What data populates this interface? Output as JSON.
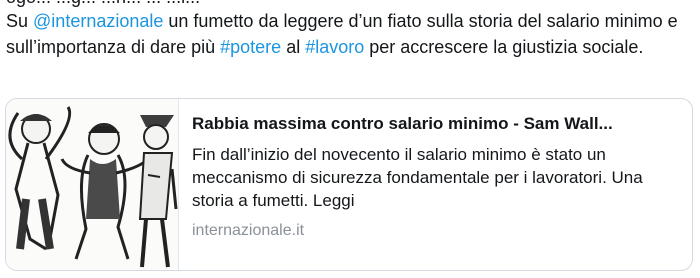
{
  "tweet": {
    "clipped_line": "ogo... ...g... ...n... ... ...l...",
    "text_before_mention": "Su ",
    "mention": "@internazionale",
    "text_part1": " un fumetto da leggere d’un fiato sulla storia del salario minimo e sull’importanza di dare più ",
    "hashtag1": "#potere",
    "text_part2": " al ",
    "hashtag2": "#lavoro",
    "text_part3": " per accrescere la giustizia sociale.",
    "link_color": "#1b95e0"
  },
  "card": {
    "image_icon": "comic-illustration-icon",
    "title": "Rabbia massima contro salario minimo - Sam Wall...",
    "description": "Fin dall’inizio del novecento il salario minimo è stato un meccanismo di sicurezza fondamentale per i lavoratori. Una storia a fumetti. Leggi",
    "domain": "internazionale.it"
  }
}
